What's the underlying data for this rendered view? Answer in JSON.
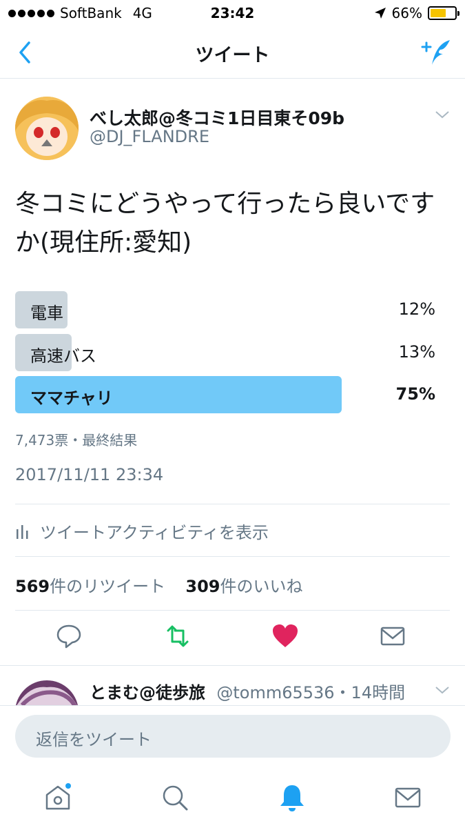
{
  "status_bar": {
    "carrier": "SoftBank",
    "network": "4G",
    "time": "23:42",
    "battery": "66%",
    "battery_level": 0.66
  },
  "nav": {
    "title": "ツイート",
    "back_icon": "chevron-left-icon",
    "compose_icon": "compose-tweet-icon"
  },
  "tweet": {
    "author_name": "べし太郎@冬コミ1日目東そ09b",
    "author_handle": "@DJ_FLANDRE",
    "text": "冬コミにどうやって行ったら良いですか(現住所:愛知)",
    "poll": {
      "options": [
        {
          "label": "電車",
          "percent_text": "12%",
          "percent": 12,
          "winner": false
        },
        {
          "label": "高速バス",
          "percent_text": "13%",
          "percent": 13,
          "winner": false
        },
        {
          "label": "ママチャリ",
          "percent_text": "75%",
          "percent": 75,
          "winner": true
        }
      ],
      "meta": "7,473票・最終結果"
    },
    "timestamp": "2017/11/11 23:34",
    "activity_label": "ツイートアクティビティを表示",
    "retweet_count": "569",
    "retweet_suffix": "件のリツイート",
    "like_count": "309",
    "like_suffix": "件のいいね"
  },
  "reply_preview": {
    "name": "とまむ@徒歩旅",
    "handle_time": "@tomm65536・14時間"
  },
  "composer": {
    "placeholder": "返信をツイート"
  },
  "colors": {
    "accent": "#1da1f2",
    "retweet_green": "#17bf63",
    "like_red": "#e0245e",
    "poll_winner": "#71c9f8",
    "poll_other": "#ccd6dd"
  }
}
